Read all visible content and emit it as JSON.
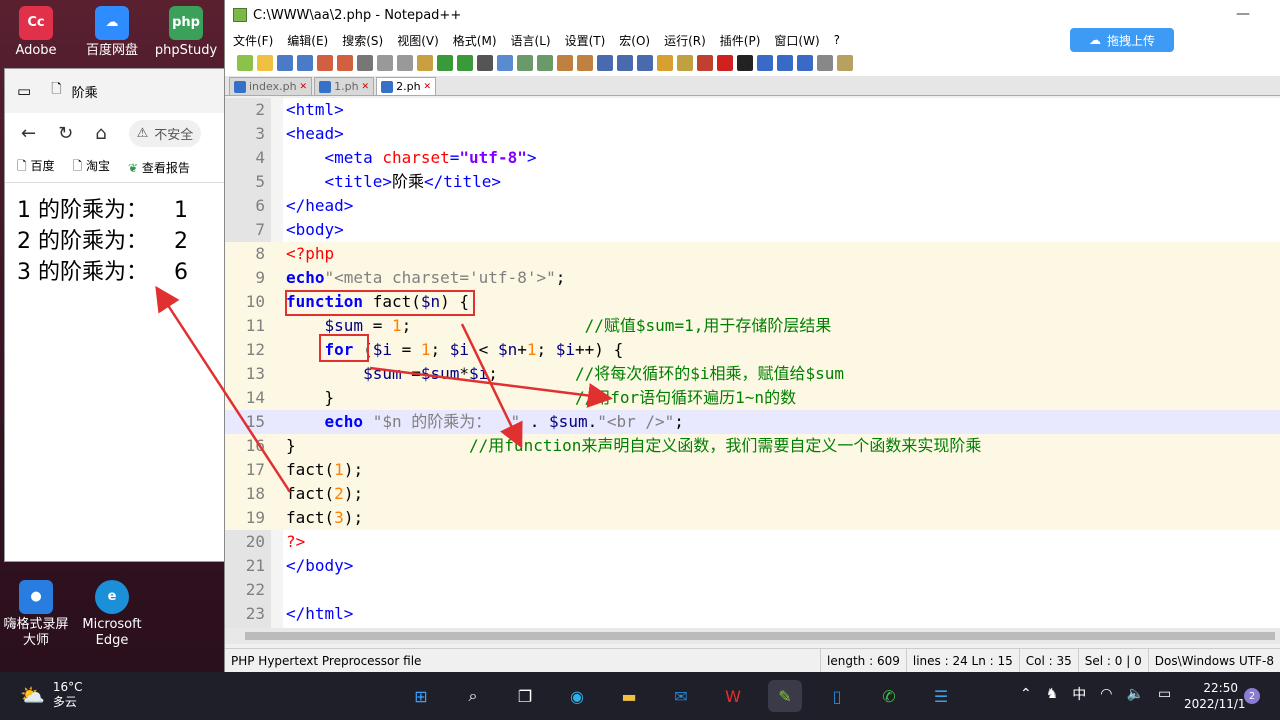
{
  "desktop": {
    "icons": [
      {
        "label": "Adobe Creati...",
        "icon": "adobe-icon",
        "color": "#e0304a"
      },
      {
        "label": "百度网盘",
        "icon": "baidu-netdisk-icon",
        "color": "#2f8cff"
      },
      {
        "label": "phpStudy",
        "icon": "phpstudy-icon",
        "color": "#3aa05a"
      },
      {
        "label": "嗨格式录屏大师",
        "icon": "recorder-icon",
        "color": "#2a7de0"
      },
      {
        "label": "Microsoft Edge",
        "icon": "edge-icon",
        "color": "#1b90d8"
      }
    ]
  },
  "browser": {
    "tab_title": "阶乘",
    "address_warning": "不安全",
    "bookmarks": [
      "百度",
      "淘宝",
      "查看报告"
    ],
    "output": [
      {
        "label": "1 的阶乘为：",
        "value": "1"
      },
      {
        "label": "2 的阶乘为：",
        "value": "2"
      },
      {
        "label": "3 的阶乘为：",
        "value": "6"
      }
    ]
  },
  "notepad": {
    "title": "C:\\WWW\\aa\\2.php - Notepad++",
    "menu": [
      "文件(F)",
      "编辑(E)",
      "搜索(S)",
      "视图(V)",
      "格式(M)",
      "语言(L)",
      "设置(T)",
      "宏(O)",
      "运行(R)",
      "插件(P)",
      "窗口(W)",
      "?"
    ],
    "upload_button": "拖拽上传",
    "tabs": [
      "index.ph",
      "1.ph",
      "2.ph"
    ],
    "code": {
      "l2": "<html>",
      "l3": "<head>",
      "l4a": "<meta ",
      "l4b": "charset",
      "l4c": "=",
      "l4d": "\"utf-8\"",
      "l4e": ">",
      "l5a": "<title>",
      "l5b": "阶乘",
      "l5c": "</title>",
      "l6": "</head>",
      "l7": "<body>",
      "l8": "<?php",
      "l9a": "echo",
      "l9b": "\"<meta charset='utf-8'>\"",
      "l9c": ";",
      "l10a": "function",
      "l10b": " fact(",
      "l10c": "$n",
      "l10d": ") {",
      "l11a": "$sum",
      "l11b": " = ",
      "l11c": "1",
      "l11d": ";",
      "l11e": "//赋值$sum=1,用于存储阶层结果",
      "l12a": "for",
      "l12b": " (",
      "l12c": "$i",
      "l12d": " = ",
      "l12e": "1",
      "l12f": "; ",
      "l12g": "$i",
      "l12h": " < ",
      "l12i": "$n",
      "l12j": "+",
      "l12k": "1",
      "l12l": "; ",
      "l12m": "$i",
      "l12n": "++) {",
      "l13a": "$sum",
      "l13b": " =",
      "l13c": "$sum",
      "l13d": "*",
      "l13e": "$i",
      "l13f": ";",
      "l13g": "//将每次循环的$i相乘，赋值给$sum",
      "l14a": "}",
      "l14b": "//用for语句循环遍历1~n的数",
      "l15a": "echo",
      "l15b": " \"$n 的阶乘为：  \"",
      "l15c": " . ",
      "l15d": "$sum",
      "l15e": ".",
      "l15f": "\"<br />\"",
      "l15g": ";",
      "l16a": "}",
      "l16b": "//用function来声明自定义函数，我们需要自定义一个函数来实现阶乘",
      "l17a": "fact(",
      "l17b": "1",
      "l17c": ");",
      "l18a": "fact(",
      "l18b": "2",
      "l18c": ");",
      "l19a": "fact(",
      "l19b": "3",
      "l19c": ");",
      "l20": "?>",
      "l21": "</body>",
      "l23": "</html>"
    },
    "status": {
      "file_type": "PHP Hypertext Preprocessor file",
      "length": "length : 609",
      "lines": "lines : 24",
      "ln": "Ln : 15",
      "col": "Col : 35",
      "sel": "Sel : 0 | 0",
      "eol": "Dos\\Windows",
      "encoding": "UTF-8"
    }
  },
  "taskbar": {
    "temperature": "16°C",
    "weather": "多云",
    "ime": "中",
    "time": "22:50",
    "date": "2022/11/1",
    "notifications": "2"
  }
}
